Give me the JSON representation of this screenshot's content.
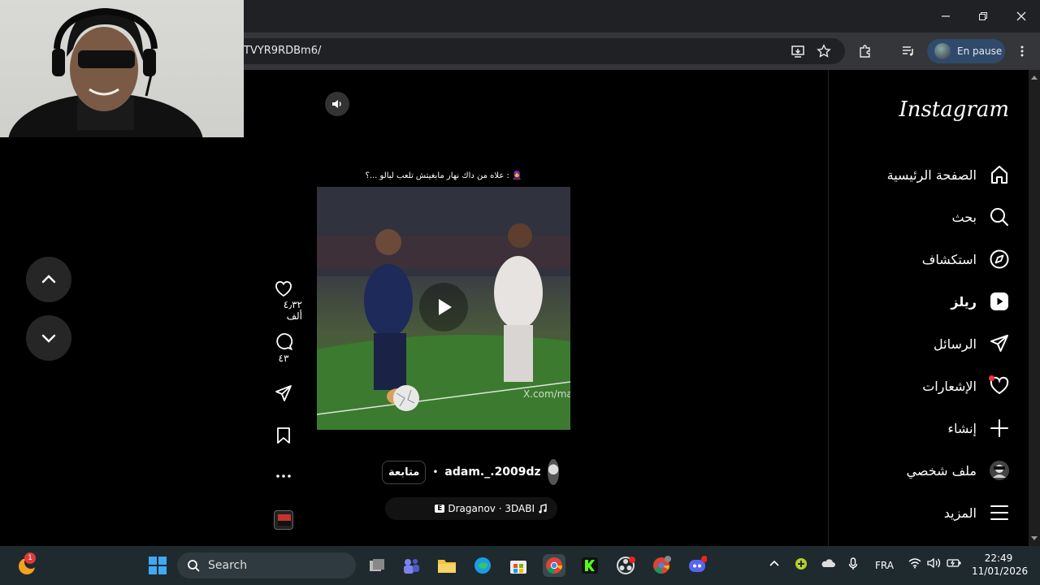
{
  "browser": {
    "url": "TVYR9RDBm6/",
    "profile_label": "En pause",
    "window_controls": [
      "minimize-icon",
      "restore-icon",
      "close-icon"
    ]
  },
  "sidebar": {
    "logo": "Instagram",
    "items": [
      {
        "label": "الصفحة الرئيسية",
        "icon": "home-icon"
      },
      {
        "label": "بحث",
        "icon": "search-icon"
      },
      {
        "label": "استكشاف",
        "icon": "compass-icon"
      },
      {
        "label": "ريلز",
        "icon": "reels-icon"
      },
      {
        "label": "الرسائل",
        "icon": "send-icon"
      },
      {
        "label": "الإشعارات",
        "icon": "heart-icon"
      },
      {
        "label": "إنشاء",
        "icon": "plus-icon"
      },
      {
        "label": "ملف شخصي",
        "icon": "profile-avatar-icon"
      },
      {
        "label": "المزيد",
        "icon": "menu-icon"
      }
    ]
  },
  "reel": {
    "caption": "🧕 : علاه من داك نهار مابغيتش تلعب لبالو ...؟",
    "watermark": "X.com/ma",
    "author": "adam._.2009dz",
    "separator": "•",
    "follow_label": "متابعة",
    "music": "Draganov · 3DABI",
    "music_badge": "E"
  },
  "actions": {
    "likes": "٤٫٣٢ ألف",
    "comments": "٤٣"
  },
  "taskbar": {
    "search_placeholder": "Search",
    "language": "FRA",
    "time": "22:49",
    "date": "11/01/2026",
    "notification_badge": "1"
  }
}
